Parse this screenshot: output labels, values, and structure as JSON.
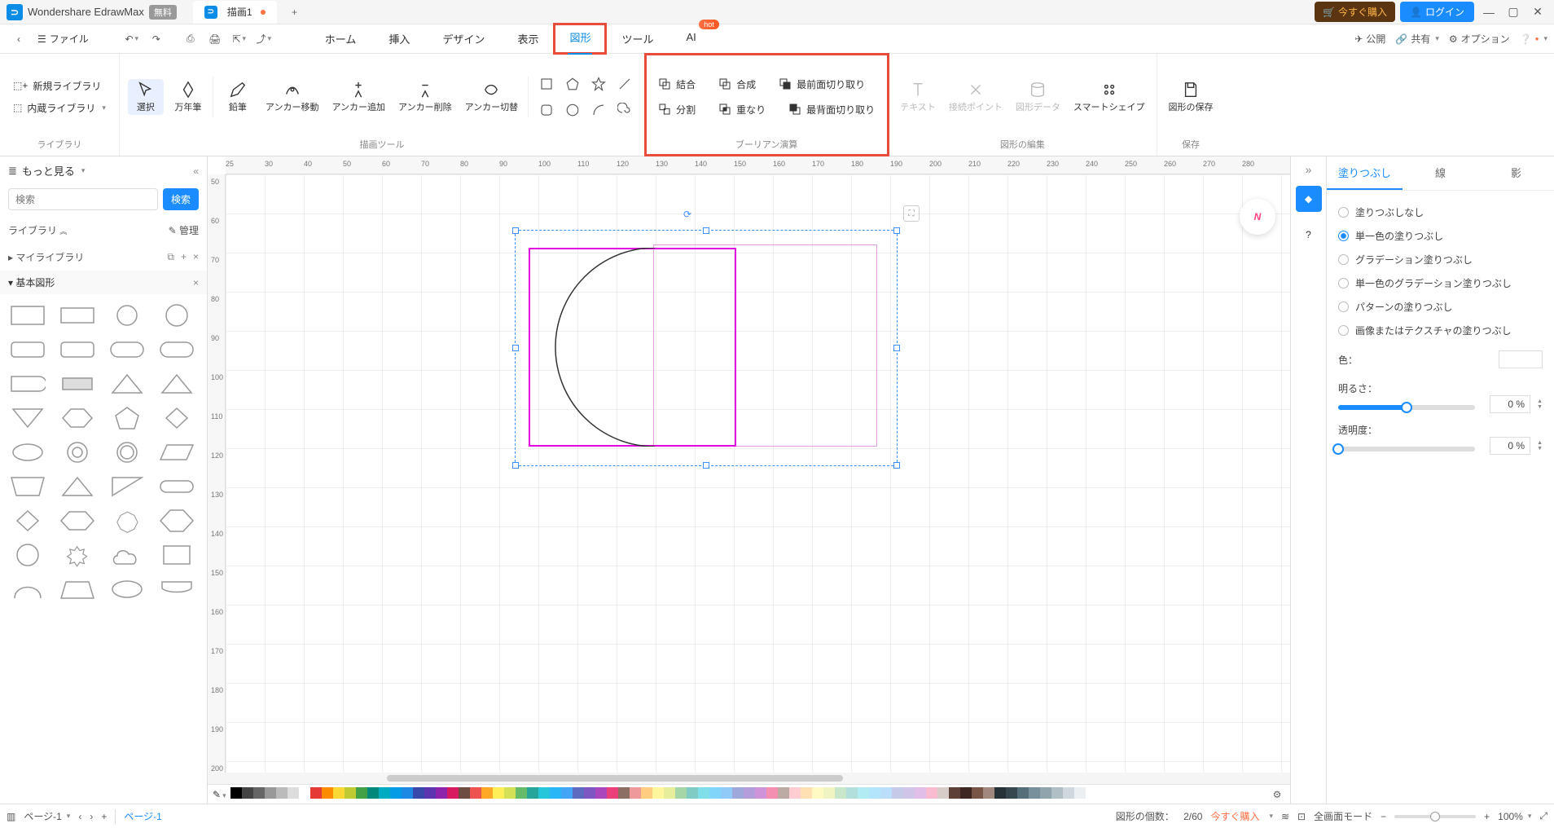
{
  "app": {
    "name": "Wondershare EdrawMax",
    "free_badge": "無料"
  },
  "doc_tab": {
    "name": "描画1"
  },
  "titlebar_buttons": {
    "buy": "今すぐ購入",
    "login": "ログイン"
  },
  "menubar": {
    "file": "ファイル",
    "tabs": [
      "ホーム",
      "挿入",
      "デザイン",
      "表示",
      "図形",
      "ツール",
      "AI"
    ],
    "hot": "hot",
    "right": {
      "publish": "公開",
      "share": "共有",
      "options": "オプション"
    }
  },
  "ribbon": {
    "library": {
      "new_lib": "新規ライブラリ",
      "builtin_lib": "内蔵ライブラリ",
      "label": "ライブラリ"
    },
    "tools": {
      "select": "選択",
      "fountain_pen": "万年筆",
      "pencil": "鉛筆",
      "anchor_move": "アンカー移動",
      "anchor_add": "アンカー追加",
      "anchor_delete": "アンカー削除",
      "anchor_switch": "アンカー切替",
      "label": "描画ツール"
    },
    "boolean": {
      "union": "結合",
      "combine": "合成",
      "front_clip": "最前面切り取り",
      "split": "分割",
      "intersect": "重なり",
      "back_clip": "最背面切り取り",
      "label": "ブーリアン演算"
    },
    "edit": {
      "text": "テキスト",
      "connections": "接続ポイント",
      "shape_data": "図形データ",
      "smart_shape": "スマートシェイプ",
      "label": "図形の編集"
    },
    "save": {
      "save_shape": "図形の保存",
      "label": "保存"
    }
  },
  "left_panel": {
    "more": "もっと見る",
    "search_placeholder": "検索",
    "search_btn": "検索",
    "library_label": "ライブラリ",
    "manage": "管理",
    "my_library": "マイライブラリ",
    "basic_shapes": "基本図形"
  },
  "right_panel": {
    "tabs": {
      "fill": "塗りつぶし",
      "line": "線",
      "shadow": "影"
    },
    "fills": {
      "none": "塗りつぶしなし",
      "solid": "単一色の塗りつぶし",
      "gradient": "グラデーション塗りつぶし",
      "solid_gradient": "単一色のグラデーション塗りつぶし",
      "pattern": "パターンの塗りつぶし",
      "image": "画像またはテクスチャの塗りつぶし"
    },
    "color_label": "色：",
    "brightness_label": "明るさ：",
    "brightness_value": "0 %",
    "opacity_label": "透明度：",
    "opacity_value": "0 %"
  },
  "statusbar": {
    "page_label": "ページ-1",
    "page_tab": "ページ-1",
    "shape_count_label": "図形の個数：",
    "shape_count": "2/60",
    "buy_now": "今すぐ購入",
    "fullscreen": "全画面モード",
    "zoom": "100%"
  },
  "ruler_h": [
    25,
    30,
    40,
    50,
    60,
    70,
    80,
    90,
    100,
    110,
    120,
    130,
    140,
    150,
    160,
    170,
    180,
    190,
    200,
    210,
    220,
    230,
    240,
    250,
    260,
    270,
    280
  ],
  "ruler_v": [
    50,
    60,
    70,
    80,
    90,
    100,
    110,
    120,
    130,
    140,
    150,
    160,
    170,
    180,
    190,
    200
  ],
  "palette": [
    "#000",
    "#444",
    "#666",
    "#999",
    "#bbb",
    "#ddd",
    "#fff",
    "#e53935",
    "#fb8c00",
    "#fdd835",
    "#c0ca33",
    "#43a047",
    "#00897b",
    "#00acc1",
    "#039be5",
    "#1e88e5",
    "#3949ab",
    "#5e35b1",
    "#8e24aa",
    "#d81b60",
    "#6d4c41",
    "#ef5350",
    "#ffa726",
    "#ffee58",
    "#d4e157",
    "#66bb6a",
    "#26a69a",
    "#26c6da",
    "#29b6f6",
    "#42a5f5",
    "#5c6bc0",
    "#7e57c2",
    "#ab47bc",
    "#ec407a",
    "#8d6e63",
    "#ef9a9a",
    "#ffcc80",
    "#fff59d",
    "#e6ee9c",
    "#a5d6a7",
    "#80cbc4",
    "#80deea",
    "#81d4fa",
    "#90caf9",
    "#9fa8da",
    "#b39ddb",
    "#ce93d8",
    "#f48fb1",
    "#bcaaa4",
    "#ffcdd2",
    "#ffe0b2",
    "#fff9c4",
    "#f0f4c3",
    "#c8e6c9",
    "#b2dfdb",
    "#b2ebf2",
    "#b3e5fc",
    "#bbdefb",
    "#c5cae9",
    "#d1c4e9",
    "#e1bee7",
    "#f8bbd0",
    "#d7ccc8",
    "#5d4037",
    "#3e2723",
    "#795548",
    "#a1887f",
    "#263238",
    "#37474f",
    "#546e7a",
    "#78909c",
    "#90a4ae",
    "#b0bec5",
    "#cfd8dc",
    "#eceff1"
  ]
}
